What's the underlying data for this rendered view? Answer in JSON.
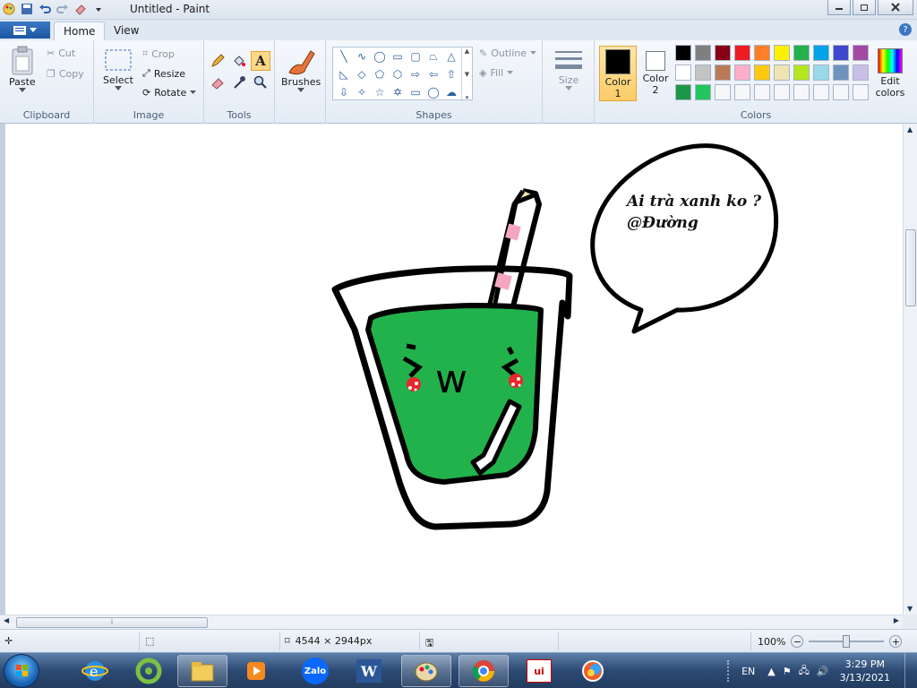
{
  "window": {
    "title": "Untitled - Paint"
  },
  "tabs": [
    {
      "label": "Home"
    },
    {
      "label": "View"
    }
  ],
  "ribbon": {
    "clipboard": {
      "label": "Clipboard",
      "paste": "Paste",
      "cut": "Cut",
      "copy": "Copy"
    },
    "image": {
      "label": "Image",
      "select": "Select",
      "crop": "Crop",
      "resize": "Resize",
      "rotate": "Rotate"
    },
    "tools": {
      "label": "Tools"
    },
    "brushes": {
      "label": "Brushes"
    },
    "shapes": {
      "label": "Shapes",
      "outline": "Outline",
      "fill": "Fill"
    },
    "size": {
      "label": "Size"
    },
    "colors": {
      "label": "Colors",
      "color1": "Color",
      "color1_num": "1",
      "color2": "Color",
      "color2_num": "2",
      "edit": "Edit",
      "edit2": "colors",
      "color1_value": "#000000",
      "color2_value": "#ffffff",
      "palette": [
        "#000000",
        "#7f7f7f",
        "#880015",
        "#ed1c24",
        "#ff7f27",
        "#fff200",
        "#22b14c",
        "#00a2e8",
        "#3f48cc",
        "#a349a4",
        "#ffffff",
        "#c3c3c3",
        "#b97a57",
        "#ffaec9",
        "#ffc90e",
        "#efe4b0",
        "#b5e61d",
        "#99d9ea",
        "#7092be",
        "#c8bfe7",
        "#1e9648",
        "#22c55e",
        "#f5f7fa",
        "#f5f7fa",
        "#f5f7fa",
        "#f5f7fa",
        "#f5f7fa",
        "#f5f7fa",
        "#f5f7fa",
        "#f5f7fa"
      ]
    }
  },
  "canvas": {
    "speech_line1": "Ai trà xanh ko ?",
    "speech_line2": "@Đường",
    "face_text": "w",
    "drink_color": "#22b24c"
  },
  "status": {
    "image_size": "4544 × 2944px",
    "zoom": "100%",
    "zoom_level": 0.5
  },
  "taskbar": {
    "apps": [
      "ie-icon",
      "coccoc-icon",
      "explorer-icon",
      "media-icon",
      "zalo-icon",
      "word-icon",
      "paint-icon",
      "chrome-icon",
      "unikey-icon",
      "photos-icon"
    ],
    "zalo_label": "Zalo",
    "word_label": "W",
    "unikey_label": "ui",
    "language": "EN",
    "time": "3:29 PM",
    "date": "3/13/2021"
  }
}
